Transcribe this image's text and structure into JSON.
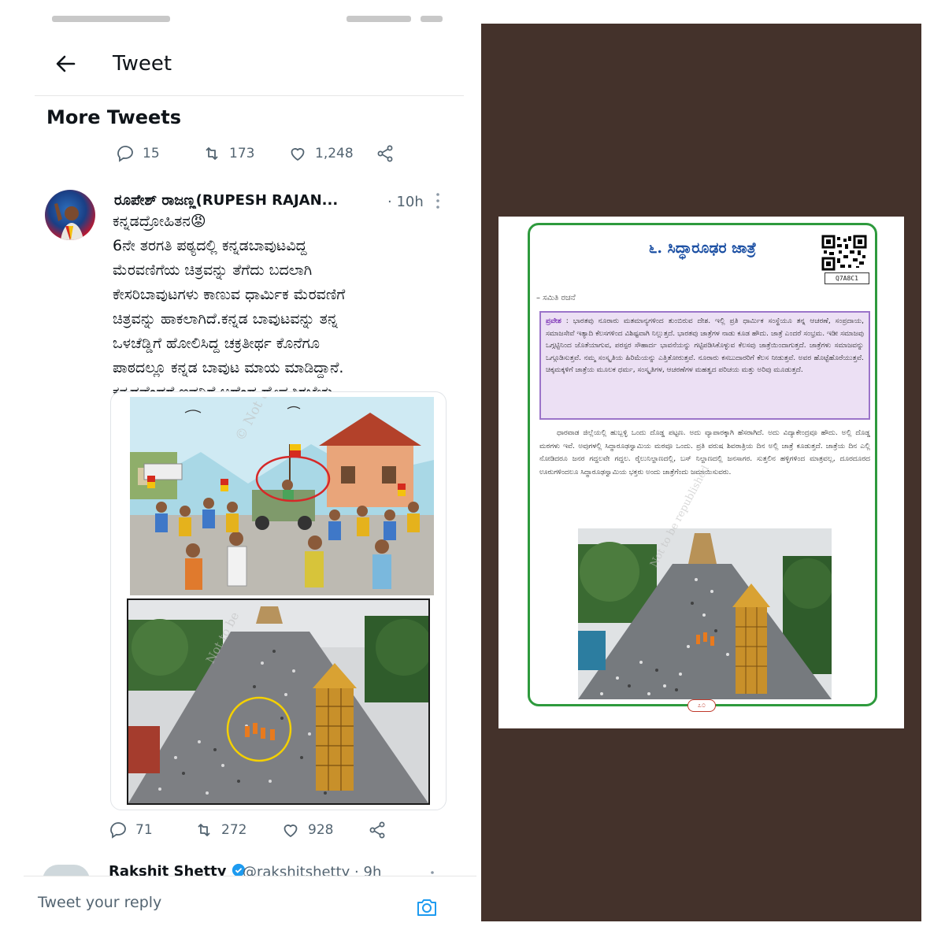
{
  "tweet_view": {
    "header": {
      "title": "Tweet"
    },
    "section_title": "More Tweets",
    "prev_tweet_actions": {
      "replies": "15",
      "retweets": "173",
      "likes": "1,248"
    },
    "tweet": {
      "author": "ರೂಪೇಶ್ ರಾಜಣ್ಣ(RUPESH RAJAN...",
      "time": "· 10h",
      "body_lines": [
        "ಕನ್ನಡದ್ರೋಹಿತನ😡",
        "6ನೇ ತರಗತಿ ಪಠ್ಯದಲ್ಲಿ ಕನ್ನಡಬಾವುಟವಿದ್ದ",
        "ಮೆರವಣಿಗೆಯ ಚಿತ್ರವನ್ನು ತೆಗೆದು ಬದಲಾಗಿ",
        "ಕೇಸರಿಬಾವುಟಗಳು ಕಾಣುವ ಧಾರ್ಮಿಕ ಮೆರವಣಿಗೆ",
        "ಚಿತ್ರವನ್ನು ಹಾಕಲಾಗಿದೆ.ಕನ್ನಡ ಬಾವುಟವನ್ನು ತನ್ನ",
        "ಒಳಚೆಡ್ಡಿಗೆ ಹೋಲಿಸಿದ್ದ ಚಕ್ರತೀರ್ಥ ಕೊನೆಗೂ",
        "ಪಾಠದಲ್ಲೂ ಕನ್ನಡ ಬಾವುಟ ಮಾಯ ಮಾಡಿದ್ದಾನೆ.",
        "ಕನ್ನಡವೆಂದರೆ ಇವನಿಗೆ ಅದೆಂಥ ದ್ವೇಷವಿರಬೇಕು."
      ],
      "media_watermarks": [
        "© Not to be r",
        "Not to be"
      ],
      "actions": {
        "replies": "71",
        "retweets": "272",
        "likes": "928"
      }
    },
    "next_tweet": {
      "author": "Rakshit Shetty",
      "handle": "@rakshitshetty · 9h"
    },
    "reply_placeholder": "Tweet your reply",
    "icons": [
      "back-arrow-icon",
      "reply-icon",
      "retweet-icon",
      "like-icon",
      "share-icon",
      "more-icon",
      "verified-icon",
      "camera-icon"
    ],
    "colors": {
      "text": "#0f1419",
      "muted": "#536471",
      "verified": "#1d9bf0",
      "circle_red": "#d62828",
      "circle_yellow": "#f4d000"
    }
  },
  "textbook_page": {
    "chapter_title": "೬. ಸಿದ್ಧಾರೂಢರ ಜಾತ್ರೆ",
    "qr_code": "Q7A8C1",
    "byline": "– ಸಮಿತಿ ರಚನೆ",
    "intro_label": "ಪ್ರವೇಶ",
    "intro_text": ": ಭಾರತವು ನೂರಾರು ಮತಮಾನ್ಯಗಳಿಂದ ತುಂಬಿರುವ ದೇಶ. ಇಲ್ಲಿ ಪ್ರತಿ ಧಾರ್ಮಿಕ ಸಂಸ್ಥೆಯೂ ತನ್ನ ಆಚರಣೆ, ಸಂಪ್ರದಾಯ, ಸಮಾಜಸೇವೆ ಇತ್ಯಾದಿ ಕೆಲಸಗಳಿಂದ ವಿಶಿಷ್ಟವಾಗಿ ನಿಲ್ಲುತ್ತದೆ. ಭಾರತವು ಜಾತ್ರೆಗಳ ನಾಡು ಕೂಡ ಹೌದು. ಜಾತ್ರೆ ಎಂದರೆ ಸಂಭ್ರಮ. ಇಡೀ ಸಮಾಜವು ಒಗ್ಗಟ್ಟಿನಿಂದ ಜೊತೆಯಾಗುವ, ಪರಸ್ಪರ ಸೌಹಾರ್ದ ಭಾವನೆಯನ್ನು ಗಟ್ಟಿಪಡಿಸಿಕೊಳ್ಳುವ ಕೆಲಸವು ಜಾತ್ರೆಯಿಂದಾಗುತ್ತದೆ. ಜಾತ್ರೆಗಳು ಸಮಾಜವನ್ನು ಒಗ್ಗೂಡಿಸುತ್ತವೆ. ನಮ್ಮ ಸಂಸ್ಕೃತಿಯ ಹಿರಿಮೆಯನ್ನು ಎತ್ತಿತೋರುತ್ತವೆ. ನೂರಾರು ಕಸಬುದಾರರಿಗೆ ಕೆಲಸ ನೀಡುತ್ತವೆ. ಅವರ ಹೊಟ್ಟೆಹೊರೆಯುತ್ತವೆ. ಚಿಕ್ಕಮಕ್ಕಳಿಗೆ ಜಾತ್ರೆಯ ಮೂಲಕ ಧರ್ಮ, ಸಂಸ್ಕೃತಿಗಳ, ಆಚರಣೆಗಳ ಮಹತ್ವದ ಪರಿಚಯ ಮತ್ತು ಅರಿವು ಮೂಡುತ್ತದೆ.",
    "paragraph": "ಧಾರವಾಡ ಜಿಲ್ಲೆಯಲ್ಲಿ ಹುಬ್ಬಳ್ಳಿ ಒಂದು ದೊಡ್ಡ ಪಟ್ಟಣ. ಅದು ವ್ಯಾಪಾರಕ್ಕಾಗಿ ಹೆಸರಾಗಿದೆ. ಅದು ವಿದ್ಯಾಕೇಂದ್ರವೂ ಹೌದು. ಅಲ್ಲಿ ದೊಡ್ಡ ಮಠಗಳು ಇವೆ. ಅವುಗಳಲ್ಲಿ ಸಿದ್ಧಾರೂಢಸ್ವಾಮಿಯ ಮಠವೂ ಒಂದು. ಪ್ರತಿ ವರುಷ ಶಿವರಾತ್ರಿಯ ದಿನ ಅಲ್ಲಿ ಜಾತ್ರೆ ಕೂಡುತ್ತದೆ. ಜಾತ್ರೆಯ ದಿನ ಎಲ್ಲಿ ನೋಡಿದರೂ ಜನರ ಗದ್ದಲವೇ ಗದ್ದಲ. ರೈಲುನಿಲ್ದಾಣದಲ್ಲಿ, ಬಸ್ ನಿಲ್ದಾಣದಲ್ಲಿ ಜನಸಾಗರ. ಸುತ್ತಲಿನ ಹಳ್ಳಿಗಳಿಂದ ಮಾತ್ರವಲ್ಲ, ದೂರದೂರದ ಊರುಗಳಿಂದಲೂ ಸಿದ್ಧಾರೂಢಸ್ವಾಮಿಯ ಭಕ್ತರು ಅಂದು ಜಾತ್ರೆಗೆಂದು ಜಮಾಯಿಸುವರು.",
    "page_number": "೭೦",
    "watermark": "Not to be republished",
    "colors": {
      "frame": "#2e9a3d",
      "intro_border": "#9b74c9",
      "intro_bg": "#ece0f4",
      "backdrop": "#44322b"
    }
  }
}
